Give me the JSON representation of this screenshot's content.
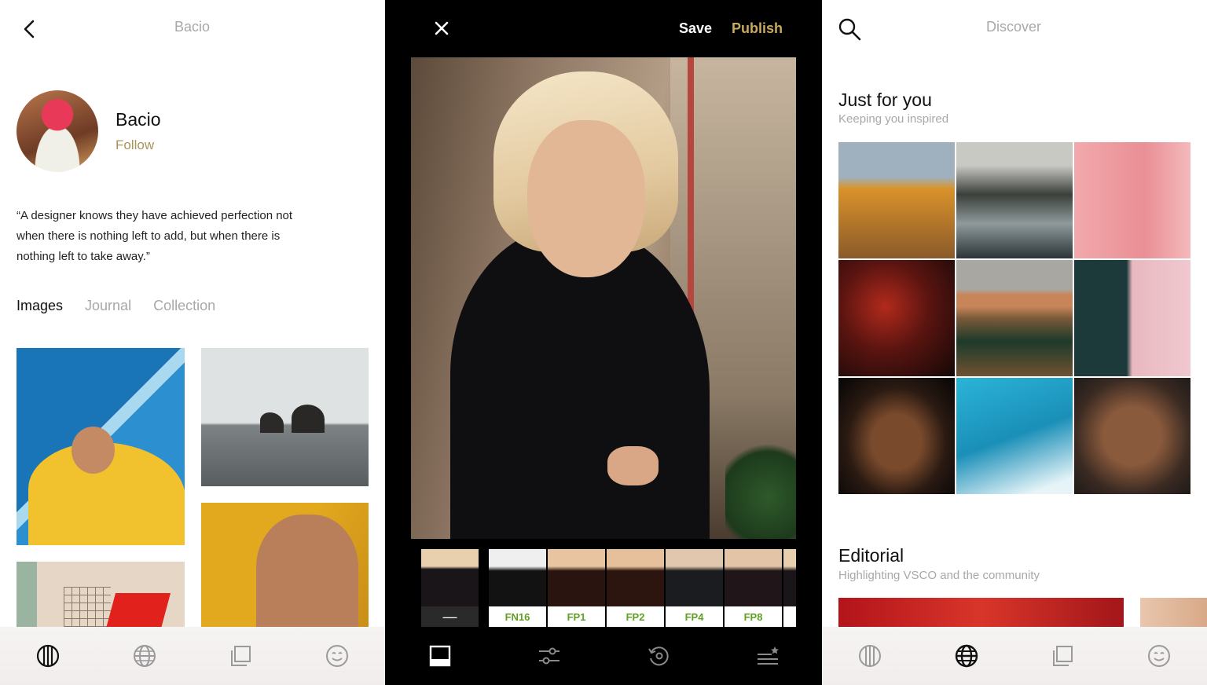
{
  "profile": {
    "title": "Bacio",
    "name": "Bacio",
    "follow_label": "Follow",
    "quote": "“A designer knows they have achieved perfection not when there is nothing left to add, but when there is nothing left to take away.”",
    "tabs": [
      "Images",
      "Journal",
      "Collection"
    ],
    "active_tab": "Images"
  },
  "editor": {
    "save_label": "Save",
    "publish_label": "Publish",
    "original_label": "—",
    "filters": [
      {
        "label": "FN16"
      },
      {
        "label": "FP1"
      },
      {
        "label": "FP2"
      },
      {
        "label": "FP4"
      },
      {
        "label": "FP8"
      }
    ]
  },
  "discover": {
    "title": "Discover",
    "just_for_you": {
      "title": "Just for you",
      "subtitle": "Keeping you inspired"
    },
    "editorial": {
      "title": "Editorial",
      "subtitle": "Highlighting VSCO and the community"
    }
  },
  "nav": {
    "icons": [
      "profile-icon",
      "globe-icon",
      "gallery-icon",
      "smiley-icon"
    ]
  },
  "colors": {
    "accent_gold": "#a8945a",
    "publish_gold": "#c9a95e",
    "filter_green": "#5fa025",
    "muted_text": "#a8a8a8"
  }
}
